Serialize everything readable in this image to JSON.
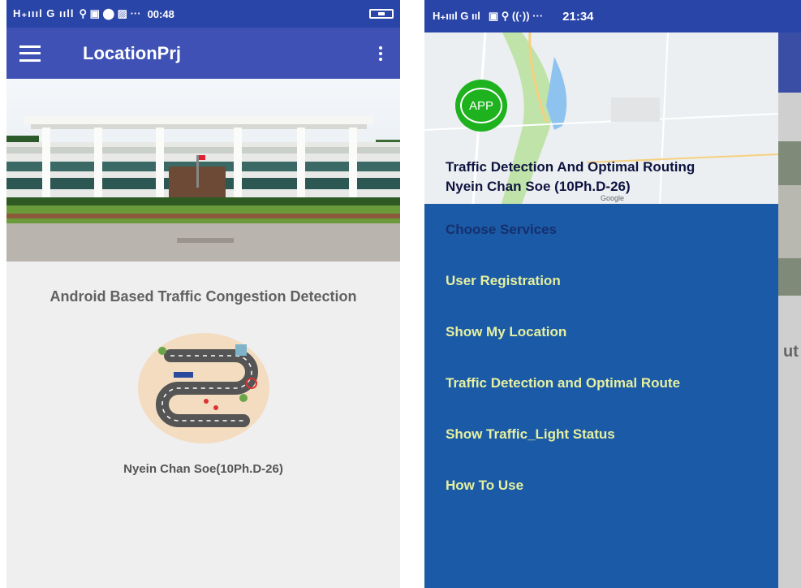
{
  "left_screen": {
    "status_bar": {
      "signal_text": "H₊ıııl G ııll",
      "icons_text": "⚲ ▣ ⬤ ▨ ···",
      "time": "00:48"
    },
    "app_bar": {
      "title": "LocationPrj"
    },
    "headline": "Android Based Traffic Congestion Detection",
    "author": "Nyein Chan Soe(10Ph.D-26)"
  },
  "right_screen": {
    "status_bar": {
      "signal_text": "H₊ıııl G ııl",
      "icons_text": "▣ ⚲ ((·)) ···",
      "time": "21:34"
    },
    "drawer_header": {
      "badge": "APP",
      "title": "Traffic Detection And Optimal Routing",
      "subtitle": "Nyein Chan Soe (10Ph.D-26)",
      "map_credit": "Google"
    },
    "menu": [
      {
        "label": "Choose Services",
        "section": true
      },
      {
        "label": "User Registration"
      },
      {
        "label": "Show My Location"
      },
      {
        "label": "Traffic Detection and Optimal Route"
      },
      {
        "label": "Show Traffic_Light Status"
      },
      {
        "label": "How To Use"
      }
    ],
    "behind_peek": "ut"
  },
  "colors": {
    "app_bar": "#3f51b5",
    "status_bar": "#2a45a8",
    "drawer_bg": "#1b5aa6",
    "menu_text": "#e6f0a0",
    "badge_green": "#1eb21e"
  }
}
